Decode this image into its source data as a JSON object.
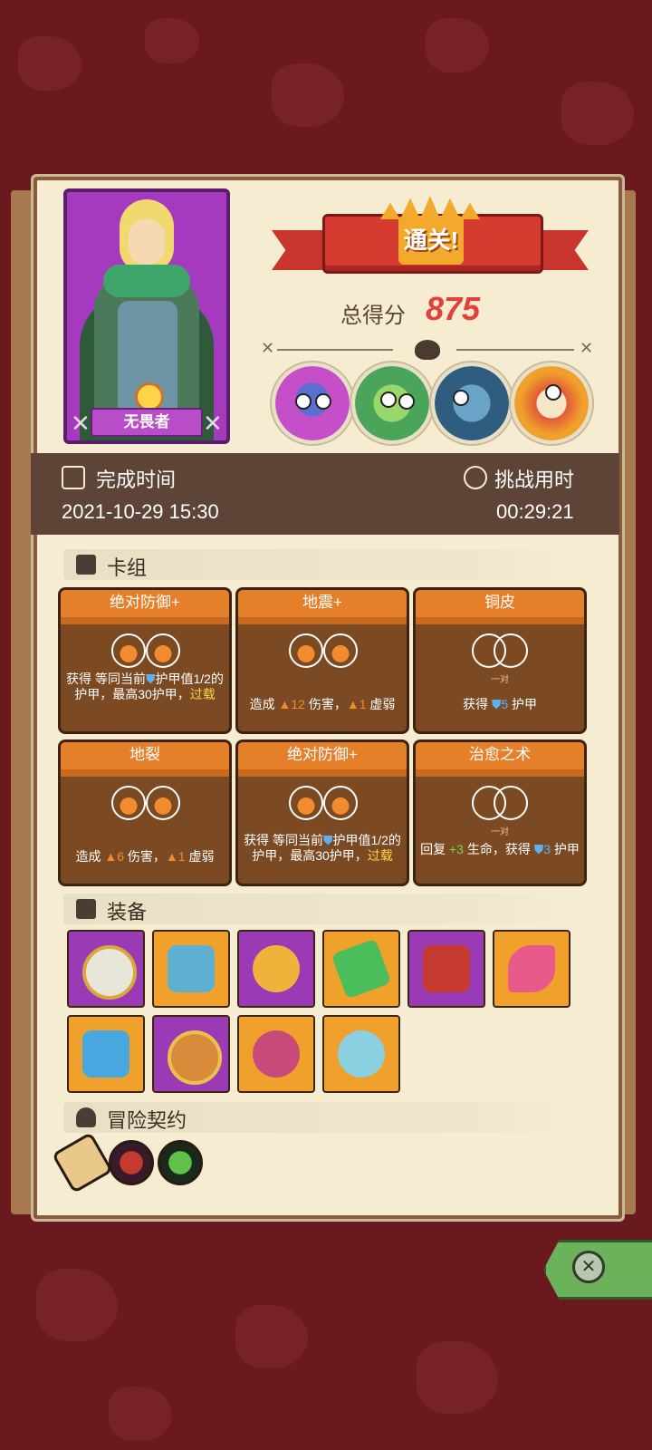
{
  "result": {
    "banner_title": "通关!",
    "score_label": "总得分",
    "score_value": "875"
  },
  "hero": {
    "name": "无畏者",
    "card_color": "#a43bbf"
  },
  "bosses": [
    {
      "name": "purple-monster",
      "color": "#c54fc8"
    },
    {
      "name": "green-goblin",
      "color": "#7fcf4a"
    },
    {
      "name": "blue-shark",
      "color": "#4a8fb8"
    },
    {
      "name": "fire-mask",
      "color": "#e25a3a"
    }
  ],
  "stats": {
    "completion_label": "完成时间",
    "completion_value": "2021-10-29 15:30",
    "duration_label": "挑战用时",
    "duration_value": "00:29:21"
  },
  "sections": {
    "deck": "卡组",
    "equipment": "装备",
    "contract": "冒险契约"
  },
  "cards": [
    {
      "title": "绝对防御+",
      "slots": "filled",
      "desc_a": "获得 等同当前",
      "desc_b": "护甲值1/2的护甲，最高30护甲，",
      "desc_hl": "过载"
    },
    {
      "title": "地震+",
      "slots": "filled",
      "desc": "造成 ",
      "damage": "12",
      "mid": " 伤害，",
      "weak": "1",
      "tail": " 虚弱"
    },
    {
      "title": "铜皮",
      "slots": "empty",
      "pair_label": "一对",
      "desc": "获得 ",
      "armor": "5",
      "tail": " 护甲"
    },
    {
      "title": "地裂",
      "slots": "filled",
      "desc": "造成 ",
      "damage": "6",
      "mid": " 伤害，",
      "weak": "1",
      "tail": " 虚弱"
    },
    {
      "title": "绝对防御+",
      "slots": "filled",
      "desc_a": "获得 等同当前",
      "desc_b": "护甲值1/2的护甲，最高30护甲，",
      "desc_hl": "过载"
    },
    {
      "title": "治愈之术",
      "slots": "empty",
      "pair_label": "一对",
      "desc": "回复 ",
      "heal": "+3",
      "mid": " 生命，获得 ",
      "armor": "3",
      "tail": " 护甲"
    }
  ],
  "equipment": [
    {
      "name": "mirror-icon",
      "bg": "#9a3bb5"
    },
    {
      "name": "mask-icon",
      "bg": "#f0a12b"
    },
    {
      "name": "potion-heart-icon",
      "bg": "#9a3bb5"
    },
    {
      "name": "green-slab-icon",
      "bg": "#f0a12b"
    },
    {
      "name": "red-bracer-icon",
      "bg": "#9a3bb5"
    },
    {
      "name": "flame-feather-icon",
      "bg": "#f0a12b"
    },
    {
      "name": "blue-shield-icon",
      "bg": "#f0a12b"
    },
    {
      "name": "hex-amulet-icon",
      "bg": "#9a3bb5"
    },
    {
      "name": "pink-heart-icon",
      "bg": "#f0a12b"
    },
    {
      "name": "blue-vase-icon",
      "bg": "#f0a12b"
    }
  ],
  "contracts": [
    {
      "name": "scroll-icon"
    },
    {
      "name": "red-banner-icon"
    },
    {
      "name": "green-coin-icon"
    }
  ]
}
